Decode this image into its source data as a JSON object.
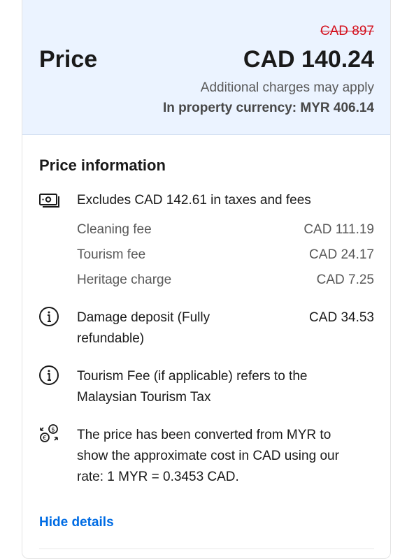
{
  "header": {
    "old_price": "CAD 897",
    "price_label": "Price",
    "price_value": "CAD 140.24",
    "additional_charges": "Additional charges may apply",
    "property_currency": "In property currency: MYR 406.14"
  },
  "price_info": {
    "title": "Price information",
    "taxes_summary": {
      "icon": "money-bills-icon",
      "text": "Excludes CAD 142.61 in taxes and fees"
    },
    "fees": [
      {
        "label": "Cleaning fee",
        "value": "CAD 111.19"
      },
      {
        "label": "Tourism fee",
        "value": "CAD 24.17"
      },
      {
        "label": "Heritage charge",
        "value": "CAD 7.25"
      }
    ],
    "deposit": {
      "icon": "info-icon",
      "line1": "Damage deposit (Fully",
      "line2": "refundable)",
      "value": "CAD 34.53"
    },
    "tourism_note": {
      "icon": "info-icon",
      "line1": "Tourism Fee (if applicable) refers to the",
      "line2": "Malaysian Tourism Tax"
    },
    "conversion_note": {
      "icon": "currency-exchange-icon",
      "line1": "The price has been converted from MYR to",
      "line2": "show the approximate cost in CAD using our",
      "line3": "rate: 1 MYR = 0.3453 CAD."
    }
  },
  "actions": {
    "hide_details": "Hide details"
  },
  "colors": {
    "header_bg": "#ebf3ff",
    "strike_red": "#d4111e",
    "link_blue": "#006ce4"
  }
}
